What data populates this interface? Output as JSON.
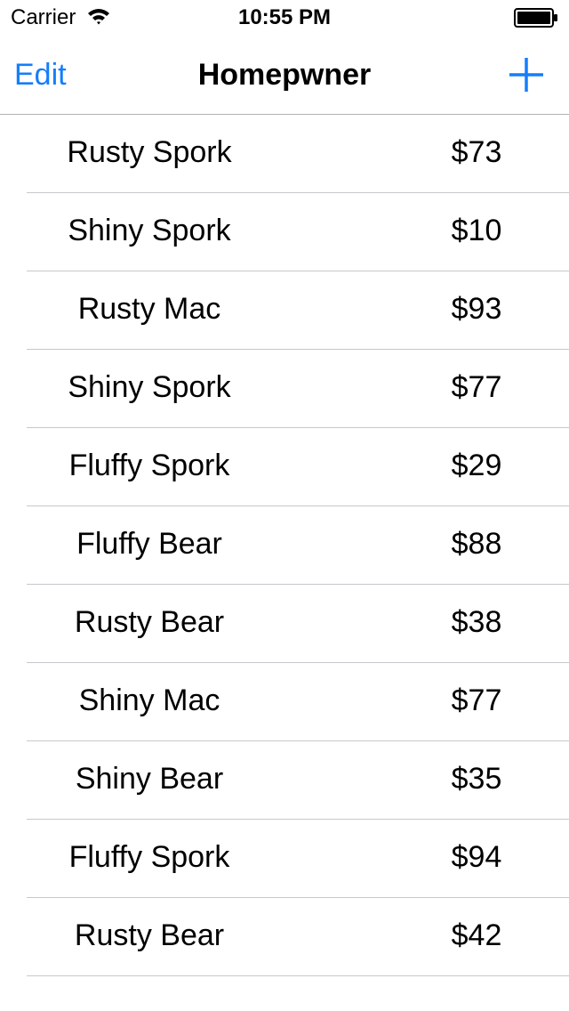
{
  "status_bar": {
    "carrier": "Carrier",
    "time": "10:55 PM"
  },
  "nav": {
    "edit_label": "Edit",
    "title": "Homepwner",
    "add_icon": "plus-icon",
    "accent_color": "#147efb"
  },
  "items": [
    {
      "name": "Rusty Spork",
      "value": "$73"
    },
    {
      "name": "Shiny Spork",
      "value": "$10"
    },
    {
      "name": "Rusty Mac",
      "value": "$93"
    },
    {
      "name": "Shiny Spork",
      "value": "$77"
    },
    {
      "name": "Fluffy Spork",
      "value": "$29"
    },
    {
      "name": "Fluffy Bear",
      "value": "$88"
    },
    {
      "name": "Rusty Bear",
      "value": "$38"
    },
    {
      "name": "Shiny Mac",
      "value": "$77"
    },
    {
      "name": "Shiny Bear",
      "value": "$35"
    },
    {
      "name": "Fluffy Spork",
      "value": "$94"
    },
    {
      "name": "Rusty Bear",
      "value": "$42"
    }
  ]
}
